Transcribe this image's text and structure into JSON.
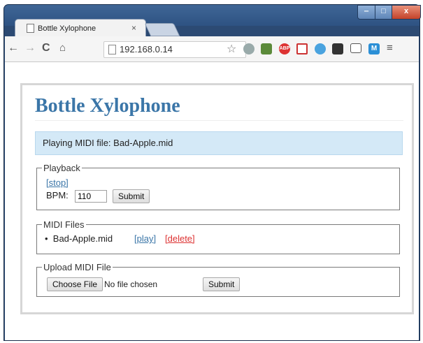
{
  "browser": {
    "tab_title": "Bottle Xylophone",
    "tab_close": "×",
    "url": "192.168.0.14",
    "window_controls": {
      "minimize": "‒",
      "maximize": "□",
      "close": "x"
    }
  },
  "page": {
    "title": "Bottle Xylophone",
    "alert": "Playing MIDI file: Bad-Apple.mid",
    "playback": {
      "legend": "Playback",
      "stop_link": "[stop]",
      "bpm_label": "BPM:",
      "bpm_value": "110",
      "submit_label": "Submit"
    },
    "midi_files": {
      "legend": "MIDI Files",
      "items": [
        {
          "name": "Bad-Apple.mid",
          "play_label": "[play]",
          "delete_label": "[delete]"
        }
      ]
    },
    "upload": {
      "legend": "Upload MIDI File",
      "choose_label": "Choose File",
      "no_file_text": "No file chosen",
      "submit_label": "Submit"
    }
  },
  "colors": {
    "heading": "#3b76a8",
    "alert_bg": "#d4e9f7",
    "delete_link": "#dd3333",
    "link": "#3b76a8"
  }
}
